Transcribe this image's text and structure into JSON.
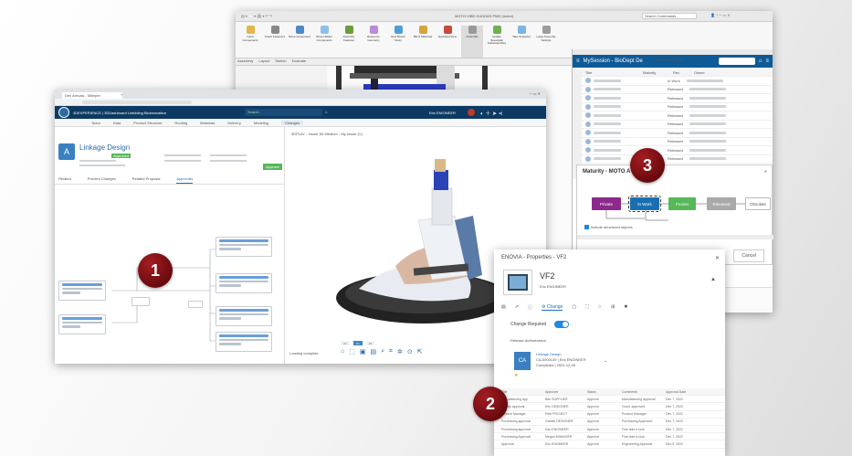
{
  "back_window": {
    "title": "MOTO VIBE GUDHAS PMD (motor)",
    "search_placeholder": "Search Commands",
    "ribbon": [
      "Insert Components",
      "Smart Fasteners",
      "Move Component",
      "Show Hidden Components",
      "Assembly Features",
      "Reference Geometry",
      "New Motion Study",
      "Bill of Materials",
      "Exploded View",
      "Instant3D",
      "Update Speedpak Subassemblies",
      "Take Snapshot",
      "Large Assembly Settings"
    ],
    "tabs": [
      "Assembly",
      "Layout",
      "Sketch",
      "Evaluate"
    ],
    "panel_title": "3DEXPERIENCE",
    "session_label": "MySession - BioDept De",
    "columns": [
      "Title",
      "Maturity",
      "Rev",
      "Owner"
    ],
    "rows": [
      {
        "maturity": "In Work"
      },
      {
        "maturity": "Released"
      },
      {
        "maturity": "Released"
      },
      {
        "maturity": "Released"
      },
      {
        "maturity": "Released"
      },
      {
        "maturity": "Released"
      },
      {
        "maturity": "Released"
      },
      {
        "maturity": "Released"
      },
      {
        "maturity": "Released"
      },
      {
        "maturity": "Released"
      }
    ]
  },
  "maturity_dialog": {
    "title": "Maturity - MOTO A",
    "states": [
      "Private",
      "In Work",
      "Frozen",
      "Released",
      "Obsolete"
    ],
    "checkbox_label": "Include structured objects",
    "cancel": "Cancel"
  },
  "main_window": {
    "browser_tab": "Dev Arrivals - Milleper",
    "brand": "3DEXPERIENCE | 3DDashboard Unfolding Bioinnovation",
    "search_placeholder": "Search",
    "user": "Eric ENGINEER",
    "nav_tabs": [
      "Team",
      "Data",
      "Product Structure",
      "Routing",
      "Materials",
      "Delivery",
      "Modeling"
    ],
    "breadcrumb": "Changes",
    "page_title": "Linkage Design",
    "status": "Approved",
    "action_label": "Approve",
    "view_tabs": [
      "Related",
      "Prevent Changes",
      "Related Proposal",
      "Approvals"
    ],
    "viewer_title": "3DPLAY - Insole 3D Medium - My Insole (V)",
    "viewer_status": "Loading complete"
  },
  "props_window": {
    "title": "ENOVIA - Properties - VF2",
    "object_name": "VF2",
    "object_sub": "Eric ENGINEER",
    "tab_change": "Change",
    "toggle_label": "Change Required",
    "toggle_on": true,
    "section_label": "Release Authorization",
    "ca_code": "CA",
    "ca_title": "Linkage Design",
    "ca_sub1": "CA-0000139 | Eric ENGINEER",
    "ca_sub2": "Completed | 2022-12-09",
    "columns": [
      "Title",
      "Approver",
      "Status",
      "Comments",
      "Approval Date"
    ],
    "rows": [
      [
        "Manufacturing app",
        "Ben SUPPLIER",
        "Approve",
        "Manufacturing approval",
        "Dec 7, 2022"
      ],
      [
        "Quality approval",
        "Erin DESIGNER",
        "Approve",
        "Good, approved",
        "Dec 7, 2022"
      ],
      [
        "Product Manager",
        "Pete PROJECT",
        "Approve",
        "Product Manager",
        "Dec 7, 2022"
      ],
      [
        "Purchasing approval",
        "Gabbie DESIGNER",
        "Approve",
        "Purchasing Approved",
        "Dec 7, 2022"
      ],
      [
        "Purchasing approval",
        "Dan ENGINEER",
        "Approve",
        "Fine take a look",
        "Dec 7, 2022"
      ],
      [
        "Purchasing Approval",
        "Megan MANAGER",
        "Approve",
        "Fine take a look",
        "Dec 7, 2022"
      ],
      [
        "Approval",
        "Eric ENGINEER",
        "Approve",
        "Engineering Approval",
        "Dec 9, 2022"
      ]
    ]
  },
  "badges": [
    "1",
    "2",
    "3"
  ],
  "colors": {
    "badge": "#7a0f14",
    "app_bar": "#0d3a62",
    "panel_bar": "#0e5a96",
    "toggle": "#1e88e5",
    "private": "#8b2a8b",
    "in_work": "#1b6fb0",
    "frozen": "#57b85a",
    "released": "#a9a9a9"
  }
}
